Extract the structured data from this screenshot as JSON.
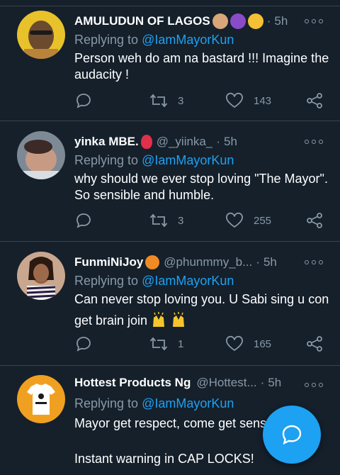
{
  "tweets": [
    {
      "name": "AMULUDUN OF LAGOS",
      "handle": "",
      "time": "5h",
      "emojis": [
        "raised-fist-emoji",
        "smiling-devil-emoji",
        "heart-eyes-emoji"
      ],
      "replying_prefix": "Replying to ",
      "replying_to": "@IamMayorKun",
      "text": [
        "Person weh do am na bastard !!! Imagine the",
        "audacity !"
      ],
      "retweets": "3",
      "likes": "143"
    },
    {
      "name": "yinka MBE.",
      "handle": "@_yiinka_",
      "time": "5h",
      "emojis": [
        "balloon-emoji"
      ],
      "replying_prefix": "Replying to ",
      "replying_to": "@IamMayorKun",
      "text": [
        "why should we ever stop loving \"The Mayor\".",
        "So sensible and humble."
      ],
      "retweets": "3",
      "likes": "255"
    },
    {
      "name": "FunmiNiJoy",
      "handle": "@phunmmy_b...",
      "time": "5h",
      "emojis": [
        "lollipop-emoji"
      ],
      "replying_prefix": "Replying to ",
      "replying_to": "@IamMayorKun",
      "text": [
        "Can never stop loving you. U Sabi sing u con",
        "get brain join"
      ],
      "retweets": "1",
      "likes": "165"
    },
    {
      "name": "Hottest Products Ng",
      "handle": "@Hottest...",
      "time": "5h",
      "emojis": [],
      "replying_prefix": "Replying to ",
      "replying_to": "@IamMayorKun",
      "text": [
        "Mayor get respect, come get sense",
        "",
        "Instant warning in CAP LOCKS!"
      ],
      "retweets": "",
      "likes": ""
    }
  ],
  "colors": {
    "background": "#15202b",
    "divider": "#38444d",
    "muted": "#8899a6",
    "accent": "#1da1f2"
  }
}
